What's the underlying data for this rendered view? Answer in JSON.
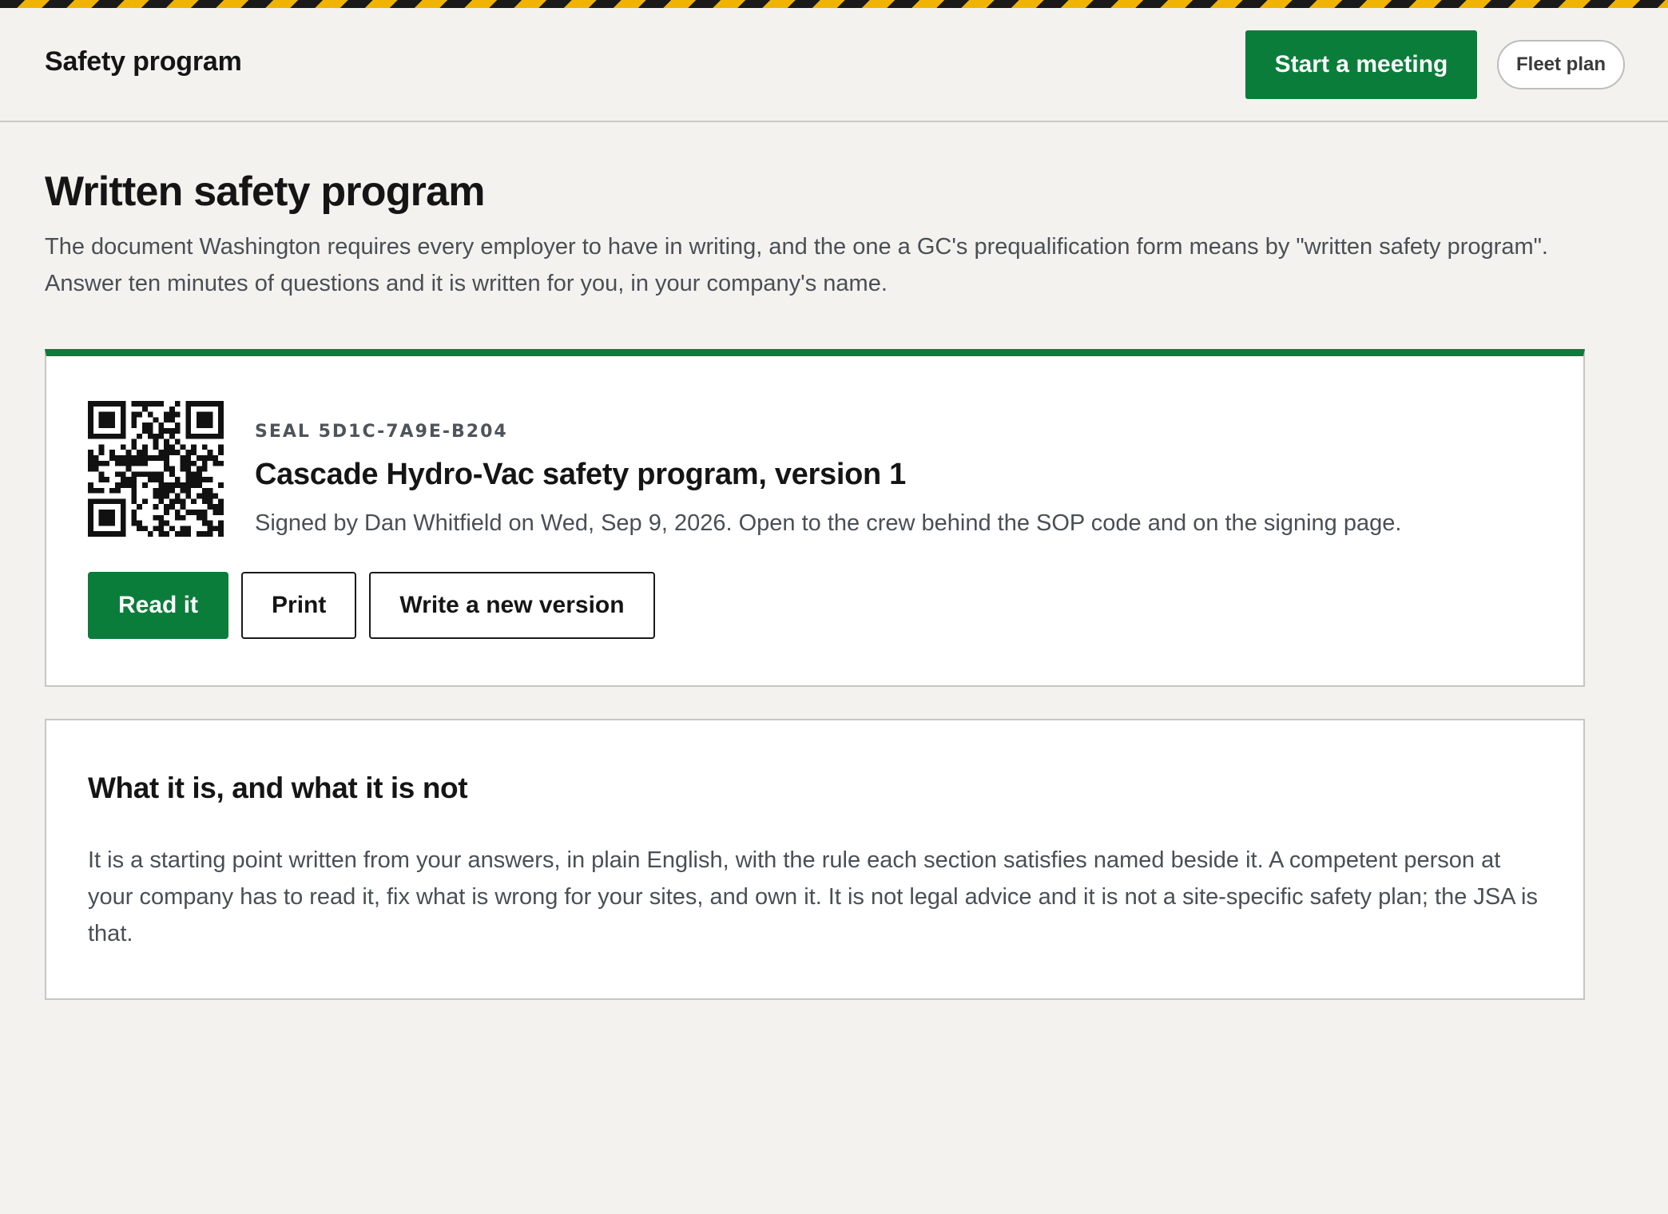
{
  "header": {
    "brand": "Safety program",
    "start_meeting_label": "Start a meeting",
    "fleet_plan_label": "Fleet plan"
  },
  "page": {
    "title": "Written safety program",
    "intro": "The document Washington requires every employer to have in writing, and the one a GC's prequalification form means by \"written safety program\". Answer ten minutes of questions and it is written for you, in your company's name."
  },
  "seal_card": {
    "seal_code": "SEAL 5D1C-7A9E-B204",
    "title": "Cascade Hydro-Vac safety program, version 1",
    "meta": "Signed by Dan Whitfield on Wed, Sep 9, 2026. Open to the crew behind the SOP code and on the signing page.",
    "read_label": "Read it",
    "print_label": "Print",
    "new_version_label": "Write a new version"
  },
  "info_card": {
    "heading": "What it is, and what it is not",
    "body": "It is a starting point written from your answers, in plain English, with the rule each section satisfies named beside it. A competent person at your company has to read it, fix what is wrong for your sites, and own it. It is not legal advice and it is not a site-specific safety plan; the JSA is that."
  },
  "colors": {
    "accent_green": "#0a7d3a",
    "hazard_yellow": "#f0b400",
    "background": "#f3f2ef"
  }
}
